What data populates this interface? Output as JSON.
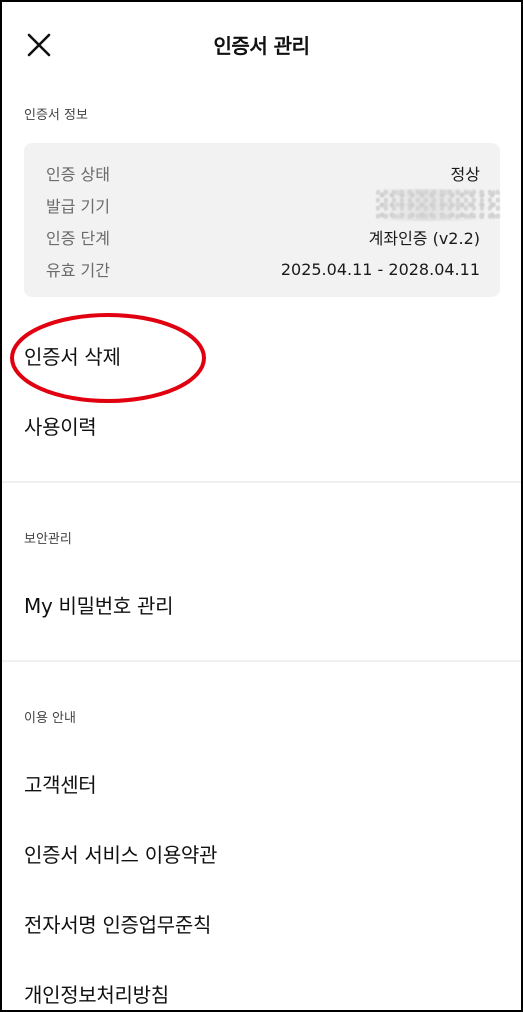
{
  "header": {
    "title": "인증서 관리",
    "close_icon": "close-icon"
  },
  "cert_info": {
    "section_label": "인증서 정보",
    "rows": [
      {
        "label": "인증 상태",
        "value": "정상"
      },
      {
        "label": "발급 기기",
        "value": ""
      },
      {
        "label": "인증 단계",
        "value": "계좌인증 (v2.2)"
      },
      {
        "label": "유효 기간",
        "value": "2025.04.11 - 2028.04.11"
      }
    ]
  },
  "cert_menu": {
    "delete_label": "인증서 삭제",
    "history_label": "사용이력"
  },
  "security": {
    "section_label": "보안관리",
    "password_label": "My 비밀번호 관리"
  },
  "usage_guide": {
    "section_label": "이용 안내",
    "items": [
      "고객센터",
      "인증서 서비스 이용약관",
      "전자서명 인증업무준칙",
      "개인정보처리방침"
    ]
  },
  "colors": {
    "annotation_circle": "#e0000f",
    "card_background": "#f2f2f3"
  }
}
